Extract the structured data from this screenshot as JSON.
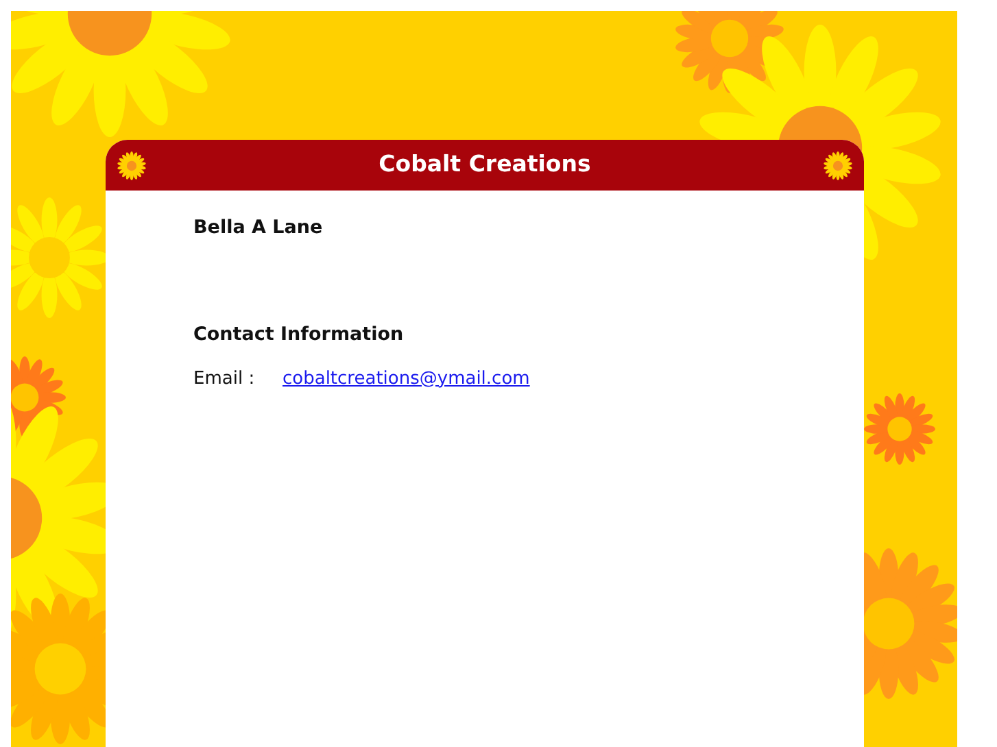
{
  "header": {
    "title": "Cobalt Creations"
  },
  "profile": {
    "name": "Bella A Lane"
  },
  "contact": {
    "heading": "Contact Information",
    "fields": [
      {
        "label": "Email :",
        "value": "cobaltcreations@ymail.com",
        "kind": "link"
      }
    ]
  }
}
